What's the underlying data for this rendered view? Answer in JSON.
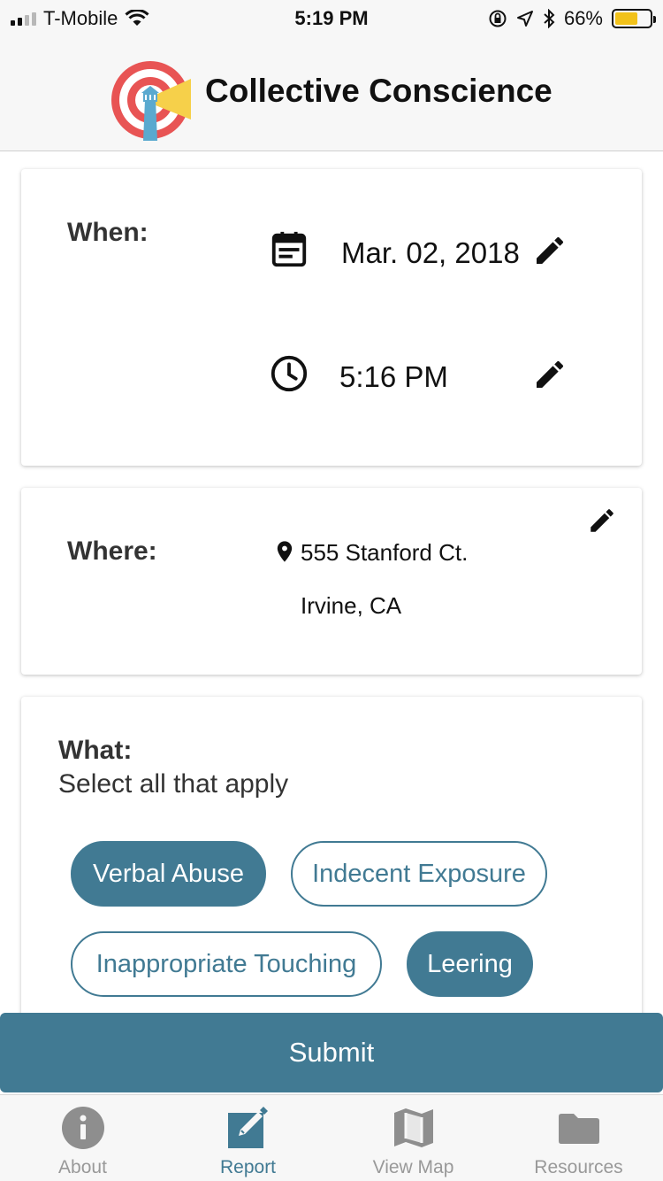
{
  "status_bar": {
    "carrier": "T-Mobile",
    "time": "5:19 PM",
    "battery_percent": "66%",
    "battery_level": 0.66,
    "icons": [
      "signal-icon",
      "wifi-icon",
      "orientation-lock-icon",
      "location-arrow-icon",
      "bluetooth-icon",
      "battery-icon"
    ]
  },
  "header": {
    "title": "Collective Conscience",
    "logo_icon": "lighthouse-target-logo"
  },
  "when": {
    "label": "When:",
    "date": "Mar. 02, 2018",
    "time": "5:16 PM",
    "date_icon": "calendar-icon",
    "time_icon": "clock-icon",
    "edit_icon": "pencil-icon"
  },
  "where": {
    "label": "Where:",
    "address_line1": "555 Stanford Ct.",
    "address_line2": "Irvine, CA",
    "location_icon": "map-pin-icon",
    "edit_icon": "pencil-icon"
  },
  "what": {
    "label": "What:",
    "hint": "Select all that apply",
    "options": [
      {
        "label": "Verbal Abuse",
        "selected": true
      },
      {
        "label": "Indecent Exposure",
        "selected": false
      },
      {
        "label": "Inappropriate Touching",
        "selected": false
      },
      {
        "label": "Leering",
        "selected": true
      }
    ]
  },
  "submit": {
    "label": "Submit"
  },
  "tabs": [
    {
      "label": "About",
      "icon": "info-icon",
      "active": false
    },
    {
      "label": "Report",
      "icon": "edit-report-icon",
      "active": true
    },
    {
      "label": "View Map",
      "icon": "map-icon",
      "active": false
    },
    {
      "label": "Resources",
      "icon": "folder-icon",
      "active": false
    }
  ],
  "colors": {
    "accent": "#417a93",
    "inactive_tab": "#999999",
    "header_bg": "#f7f7f7",
    "battery": "#f2c21a",
    "logo_red": "#e85454",
    "logo_yellow": "#f6d04a",
    "logo_blue": "#5aa9cf"
  }
}
